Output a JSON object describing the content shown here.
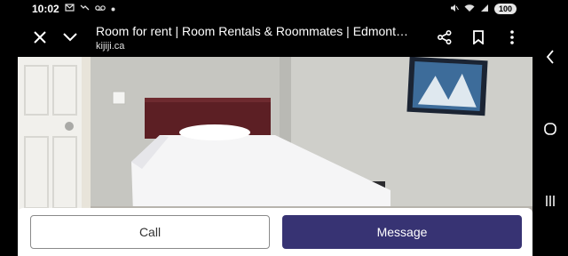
{
  "status_bar": {
    "time": "10:02",
    "notification_icons": [
      "gmail-icon",
      "missed-call-icon",
      "voicemail-icon",
      "dot-icon"
    ],
    "system_icons": [
      "mute-icon",
      "wifi-icon",
      "signal-icon"
    ],
    "battery": "100"
  },
  "toolbar": {
    "title": "Room for rent | Room Rentals & Roommates | Edmonton | ...",
    "domain": "kijiji.ca"
  },
  "listing": {
    "photo_description": "bedroom-with-bed-photo"
  },
  "actions": {
    "call_label": "Call",
    "message_label": "Message"
  },
  "colors": {
    "message_button": "#373373",
    "toolbar_bg": "#000000",
    "call_border": "#8a8a8a"
  }
}
